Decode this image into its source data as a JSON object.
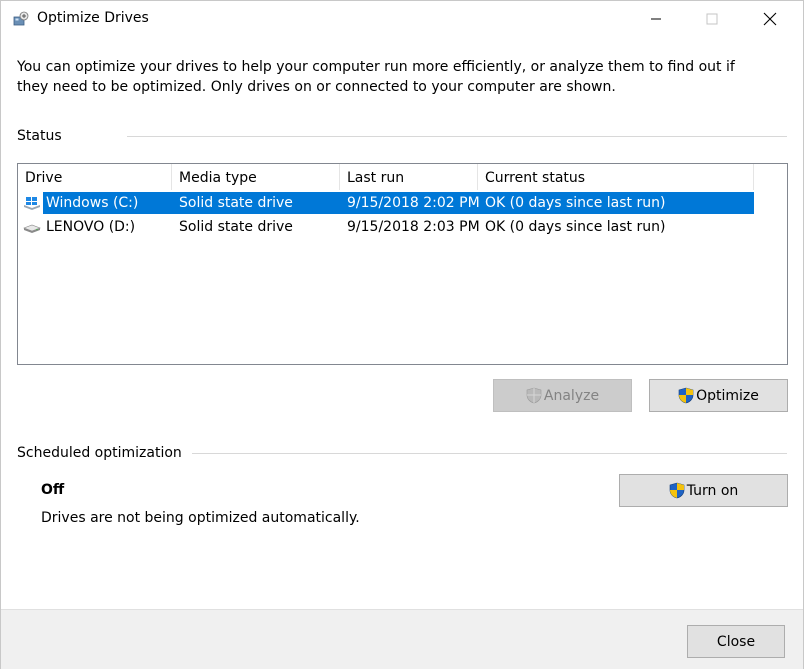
{
  "window": {
    "title": "Optimize Drives",
    "minimize_label": "Minimize",
    "maximize_label": "Maximize",
    "close_label": "Close window"
  },
  "intro_text": "You can optimize your drives to help your computer run more efficiently, or analyze them to find out if they need to be optimized. Only drives on or connected to your computer are shown.",
  "status": {
    "label": "Status",
    "columns": [
      "Drive",
      "Media type",
      "Last run",
      "Current status"
    ],
    "rows": [
      {
        "drive": "Windows (C:)",
        "media_type": "Solid state drive",
        "last_run": "9/15/2018 2:02 PM",
        "status": "OK (0 days since last run)",
        "selected": true,
        "icon": "windows-drive-icon"
      },
      {
        "drive": "LENOVO (D:)",
        "media_type": "Solid state drive",
        "last_run": "9/15/2018 2:03 PM",
        "status": "OK (0 days since last run)",
        "selected": false,
        "icon": "hard-drive-icon"
      }
    ],
    "analyze_label": "Analyze",
    "optimize_label": "Optimize"
  },
  "scheduled": {
    "label": "Scheduled optimization",
    "state": "Off",
    "description": "Drives are not being optimized automatically.",
    "turn_on_label": "Turn on"
  },
  "footer": {
    "close_label": "Close"
  },
  "colors": {
    "selection": "#0078d7",
    "button_face": "#e1e1e1",
    "footer_bg": "#f0f0f0"
  }
}
